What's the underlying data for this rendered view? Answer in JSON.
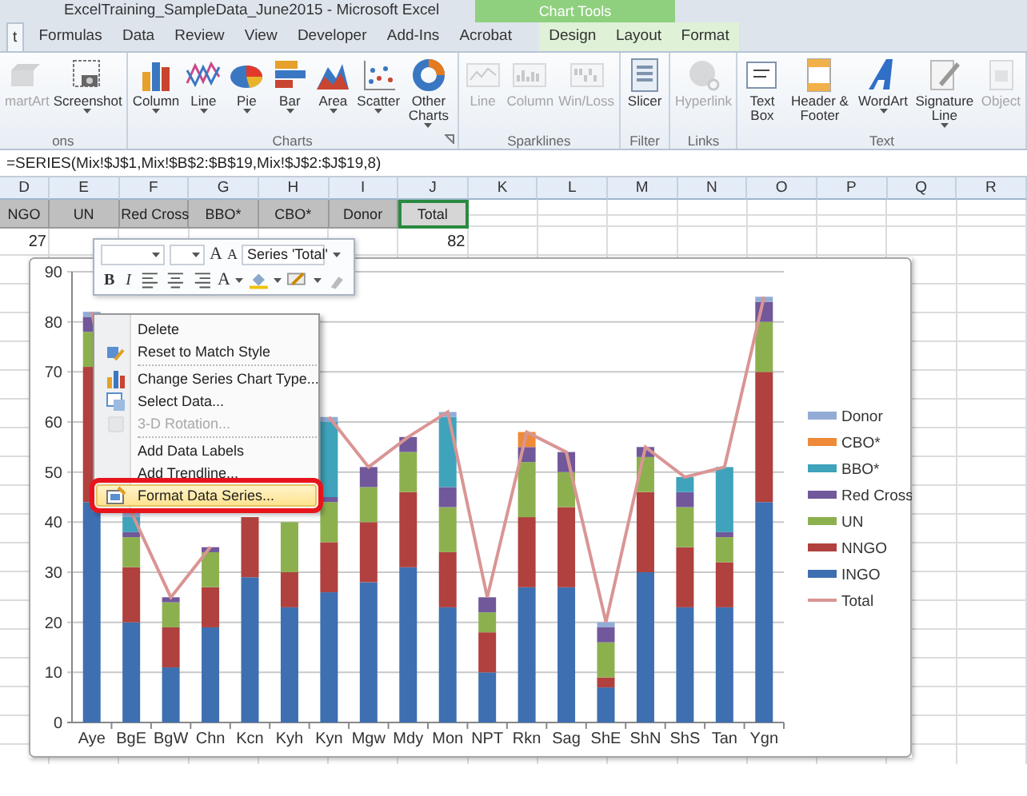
{
  "window": {
    "title": "ExcelTraining_SampleData_June2015 - Microsoft Excel"
  },
  "ribbon": {
    "contextual_group": "Chart Tools",
    "tabs": [
      {
        "label": "t",
        "selected": true,
        "contextual": false
      },
      {
        "label": "Formulas",
        "selected": false,
        "contextual": false
      },
      {
        "label": "Data",
        "selected": false,
        "contextual": false
      },
      {
        "label": "Review",
        "selected": false,
        "contextual": false
      },
      {
        "label": "View",
        "selected": false,
        "contextual": false
      },
      {
        "label": "Developer",
        "selected": false,
        "contextual": false
      },
      {
        "label": "Add-Ins",
        "selected": false,
        "contextual": false
      },
      {
        "label": "Acrobat",
        "selected": false,
        "contextual": false
      },
      {
        "label": "Design",
        "selected": false,
        "contextual": true
      },
      {
        "label": "Layout",
        "selected": false,
        "contextual": true
      },
      {
        "label": "Format",
        "selected": false,
        "contextual": true
      }
    ],
    "groups": [
      {
        "name": "ons",
        "launcher": false,
        "buttons": [
          {
            "label": "martArt",
            "kind": "smartart",
            "disabled": true,
            "dropdown": false
          },
          {
            "label": "Screenshot",
            "kind": "screenshot",
            "disabled": false,
            "dropdown": true
          }
        ]
      },
      {
        "name": "Charts",
        "launcher": true,
        "buttons": [
          {
            "label": "Column",
            "kind": "column",
            "disabled": false,
            "dropdown": true
          },
          {
            "label": "Line",
            "kind": "line",
            "disabled": false,
            "dropdown": true
          },
          {
            "label": "Pie",
            "kind": "pie",
            "disabled": false,
            "dropdown": true
          },
          {
            "label": "Bar",
            "kind": "bar",
            "disabled": false,
            "dropdown": true
          },
          {
            "label": "Area",
            "kind": "area",
            "disabled": false,
            "dropdown": true
          },
          {
            "label": "Scatter",
            "kind": "scatter",
            "disabled": false,
            "dropdown": true
          },
          {
            "label": "Other Charts",
            "kind": "other",
            "disabled": false,
            "dropdown": true
          }
        ]
      },
      {
        "name": "Sparklines",
        "launcher": false,
        "buttons": [
          {
            "label": "Line",
            "kind": "sparkline",
            "disabled": true,
            "dropdown": false
          },
          {
            "label": "Column",
            "kind": "sparkcolumn",
            "disabled": true,
            "dropdown": false
          },
          {
            "label": "Win/Loss",
            "kind": "winloss",
            "disabled": true,
            "dropdown": false
          }
        ]
      },
      {
        "name": "Filter",
        "launcher": false,
        "buttons": [
          {
            "label": "Slicer",
            "kind": "slicer",
            "disabled": false,
            "dropdown": false
          }
        ]
      },
      {
        "name": "Links",
        "launcher": false,
        "buttons": [
          {
            "label": "Hyperlink",
            "kind": "hyperlink",
            "disabled": true,
            "dropdown": false
          }
        ]
      },
      {
        "name": "Text",
        "launcher": false,
        "buttons": [
          {
            "label": "Text Box",
            "kind": "textbox",
            "disabled": false,
            "dropdown": false
          },
          {
            "label": "Header & Footer",
            "kind": "header",
            "disabled": false,
            "dropdown": false
          },
          {
            "label": "WordArt",
            "kind": "wordart",
            "disabled": false,
            "dropdown": true
          },
          {
            "label": "Signature Line",
            "kind": "signature",
            "disabled": false,
            "dropdown": true
          },
          {
            "label": "Object",
            "kind": "object",
            "disabled": true,
            "dropdown": false
          }
        ]
      }
    ]
  },
  "formula_bar": {
    "formula": "=SERIES(Mix!$J$1,Mix!$B$2:$B$19,Mix!$J$2:$J$19,8)"
  },
  "sheet": {
    "columns": [
      "D",
      "E",
      "F",
      "G",
      "H",
      "I",
      "J",
      "K",
      "L",
      "M",
      "N",
      "O",
      "P",
      "Q",
      "R"
    ],
    "rows": [
      {
        "shaded": true,
        "cells": [
          {
            "text": "NGO",
            "selected": false
          },
          {
            "text": "UN",
            "selected": false
          },
          {
            "text": "Red Cross",
            "selected": false
          },
          {
            "text": "BBO*",
            "selected": false
          },
          {
            "text": "CBO*",
            "selected": false
          },
          {
            "text": "Donor",
            "selected": false
          },
          {
            "text": "Total",
            "selected": true
          }
        ]
      },
      {
        "shaded": false,
        "cells": [
          {
            "text": "27",
            "selected": false
          },
          null,
          null,
          null,
          null,
          null,
          {
            "text": "82",
            "selected": false
          }
        ]
      }
    ]
  },
  "chart": {
    "chart_data": {
      "type": "bar",
      "stacked": true,
      "categories": [
        "Aye",
        "BgE",
        "BgW",
        "Chn",
        "Kcn",
        "Kyh",
        "Kyn",
        "Mgw",
        "Mdy",
        "Mon",
        "NPT",
        "Rkn",
        "Sag",
        "ShE",
        "ShN",
        "ShS",
        "Tan",
        "Ygn"
      ],
      "ylim": [
        0,
        90
      ],
      "yticks": [
        0,
        10,
        20,
        30,
        40,
        50,
        60,
        70,
        80,
        90
      ],
      "grid": true,
      "legend": true,
      "series": [
        {
          "name": "INGO",
          "color": "#3e6fb0",
          "values": [
            44,
            20,
            11,
            19,
            29,
            23,
            26,
            28,
            31,
            23,
            10,
            27,
            27,
            7,
            30,
            23,
            23,
            44
          ]
        },
        {
          "name": "NNGO",
          "color": "#b0413e",
          "values": [
            27,
            11,
            8,
            8,
            12,
            7,
            10,
            12,
            15,
            11,
            8,
            14,
            16,
            2,
            16,
            12,
            9,
            26
          ]
        },
        {
          "name": "UN",
          "color": "#8db04f",
          "values": [
            7,
            6,
            5,
            7,
            null,
            10,
            8,
            7,
            8,
            9,
            4,
            11,
            7,
            7,
            7,
            8,
            5,
            10
          ]
        },
        {
          "name": "Red Cross",
          "color": "#71589a",
          "values": [
            3,
            1,
            1,
            1,
            null,
            null,
            1,
            4,
            3,
            4,
            3,
            3,
            4,
            3,
            2,
            3,
            1,
            4
          ]
        },
        {
          "name": "BBO*",
          "color": "#3fa3bb",
          "values": [
            0,
            3,
            0,
            0,
            null,
            null,
            15,
            0,
            0,
            14,
            0,
            0,
            0,
            0,
            0,
            3,
            13,
            0
          ]
        },
        {
          "name": "CBO*",
          "color": "#ee8a38",
          "values": [
            0,
            0,
            0,
            0,
            null,
            null,
            0,
            0,
            0,
            0,
            0,
            3,
            0,
            0,
            0,
            0,
            0,
            0
          ]
        },
        {
          "name": "Donor",
          "color": "#93acd6",
          "values": [
            1,
            1,
            0,
            0,
            null,
            null,
            1,
            0,
            0,
            1,
            0,
            0,
            0,
            1,
            0,
            0,
            0,
            1
          ]
        },
        {
          "name": "Total",
          "color": "#d99594",
          "type": "line",
          "values": [
            82,
            42,
            25,
            35,
            null,
            null,
            61,
            51,
            57,
            62,
            25,
            58,
            54,
            20,
            55,
            49,
            51,
            85
          ]
        }
      ]
    }
  },
  "mini_toolbar": {
    "size_buttons": [
      "A",
      "A"
    ],
    "series_selector": "Series 'Total'",
    "style_buttons": [
      "B",
      "I"
    ],
    "font_color_button": "A"
  },
  "context_menu": {
    "items": [
      {
        "label": "Delete",
        "kind": "none",
        "disabled": false,
        "selected": false,
        "separator_before": false,
        "framed": false
      },
      {
        "label": "Reset to Match Style",
        "kind": "reset",
        "disabled": false,
        "selected": false,
        "separator_before": false,
        "framed": false
      },
      {
        "label": "Change Series Chart Type...",
        "kind": "charttype",
        "disabled": false,
        "selected": false,
        "separator_before": true,
        "framed": false
      },
      {
        "label": "Select Data...",
        "kind": "data",
        "disabled": false,
        "selected": false,
        "separator_before": false,
        "framed": false
      },
      {
        "label": "3-D Rotation...",
        "kind": "rotation",
        "disabled": true,
        "selected": false,
        "separator_before": false,
        "framed": false
      },
      {
        "label": "Add Data Labels",
        "kind": "none",
        "disabled": false,
        "selected": false,
        "separator_before": true,
        "framed": false
      },
      {
        "label": "Add Trendline...",
        "kind": "none",
        "disabled": false,
        "selected": false,
        "separator_before": false,
        "framed": false
      },
      {
        "label": "Format Data Series...",
        "kind": "format",
        "disabled": false,
        "selected": true,
        "separator_before": false,
        "framed": true
      }
    ]
  }
}
